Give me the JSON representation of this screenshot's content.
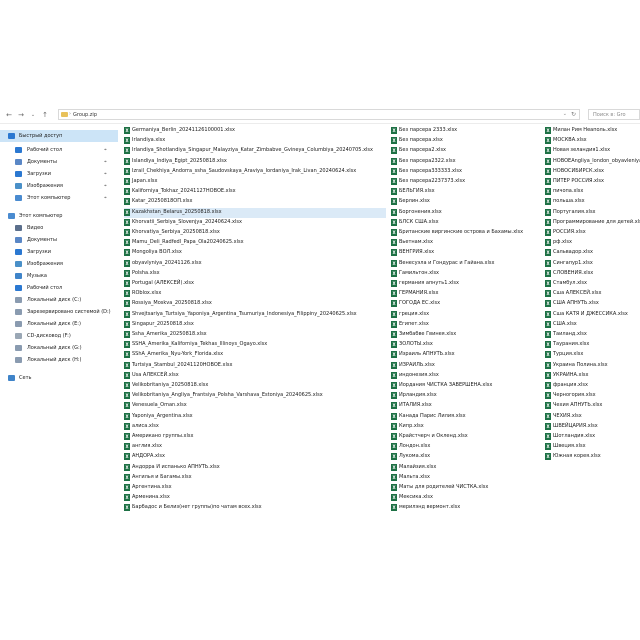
{
  "address": {
    "path": "Group.zip"
  },
  "search": {
    "placeholder": "Поиск в: Gro"
  },
  "nav": [
    {
      "label": "Быстрый доступ",
      "icon": "star-icon",
      "color": "#2b78d1",
      "pin": false,
      "sub": false,
      "active": true
    },
    {
      "label": "Рабочий стол",
      "icon": "desktop-icon",
      "color": "#2b78d1",
      "pin": true,
      "sub": true,
      "active": false
    },
    {
      "label": "Документы",
      "icon": "documents-icon",
      "color": "#5a87c6",
      "pin": true,
      "sub": true,
      "active": false
    },
    {
      "label": "Загрузки",
      "icon": "downloads-icon",
      "color": "#2b78d1",
      "pin": true,
      "sub": true,
      "active": false
    },
    {
      "label": "Изображения",
      "icon": "pictures-icon",
      "color": "#4a90c8",
      "pin": true,
      "sub": true,
      "active": false
    },
    {
      "label": "Этот компьютер",
      "icon": "computer-icon",
      "color": "#4a8bd0",
      "pin": true,
      "sub": true,
      "active": false
    },
    {
      "label": "Этот компьютер",
      "icon": "computer-icon",
      "color": "#4a8bd0",
      "pin": false,
      "sub": false,
      "active": false
    },
    {
      "label": "Видео",
      "icon": "video-icon",
      "color": "#5b6f8c",
      "pin": false,
      "sub": true,
      "active": false
    },
    {
      "label": "Документы",
      "icon": "documents-icon",
      "color": "#5a87c6",
      "pin": false,
      "sub": true,
      "active": false
    },
    {
      "label": "Загрузки",
      "icon": "downloads-icon",
      "color": "#2b78d1",
      "pin": false,
      "sub": true,
      "active": false
    },
    {
      "label": "Изображения",
      "icon": "pictures-icon",
      "color": "#4a90c8",
      "pin": false,
      "sub": true,
      "active": false
    },
    {
      "label": "Музыка",
      "icon": "music-icon",
      "color": "#3f84c9",
      "pin": false,
      "sub": true,
      "active": false
    },
    {
      "label": "Рабочий стол",
      "icon": "desktop-icon",
      "color": "#2b78d1",
      "pin": false,
      "sub": true,
      "active": false
    },
    {
      "label": "Локальный диск (C:)",
      "icon": "drive-icon",
      "color": "#8a9bb0",
      "pin": false,
      "sub": true,
      "active": false
    },
    {
      "label": "Зарезервировано системой (D:)",
      "icon": "drive-icon",
      "color": "#8a9bb0",
      "pin": false,
      "sub": true,
      "active": false
    },
    {
      "label": "Локальный диск (E:)",
      "icon": "drive-icon",
      "color": "#8a9bb0",
      "pin": false,
      "sub": true,
      "active": false
    },
    {
      "label": "CD-дисковод (F:)",
      "icon": "cd-drive-icon",
      "color": "#9aa7b5",
      "pin": false,
      "sub": true,
      "active": false
    },
    {
      "label": "Локальный диск (G:)",
      "icon": "drive-icon",
      "color": "#8a9bb0",
      "pin": false,
      "sub": true,
      "active": false
    },
    {
      "label": "Локальный диск (H:)",
      "icon": "drive-icon",
      "color": "#8a9bb0",
      "pin": false,
      "sub": true,
      "active": false
    },
    {
      "label": "Сеть",
      "icon": "network-icon",
      "color": "#3f84c9",
      "pin": false,
      "sub": false,
      "active": false
    }
  ],
  "columns": [
    [
      "Germaniya_Berlin_20241126100001.xlsx",
      "Irlandiya.xlsx",
      "Irlandiya_Shotlandiya_Singapur_Malayziya_Katar_Zimbabve_Gvineya_Columbiya_20240705.xlsx",
      "Islandiya_Indiya_Egipt_20250818.xlsx",
      "Izrail_Chekhiya_Andorra_ssha_Saudovskaya_Araviya_Iordaniya_Irak_Livan_20240624.xlsx",
      "Japan.xlsx",
      "Kaliforniya_Tokhaz_20241127НОВОЕ.xlsx",
      "Katar_20250818ОП.xlsx",
      "Kazakhstan_Belarus_20250818.xlsx",
      "Khorvatii_Serbiya_Slovenjya_20240624.xlsx",
      "Khorvatiya_Serbiya_20250818.xlsx",
      "Mamu_Deli_Radfedl_Papa_Ola20240625.xlsx",
      "Mongoliya ВОЛ.xlsx",
      "obyavlyniya_20241126.xlsx",
      "Polsha.xlsx",
      "Portugal (АЛЕКСЕЙ).xlsx",
      "ROblox.xlsx",
      "Rossiya_Moskva_20250818.xlsx",
      "Shvejtsariya_Turtsiya_Yaponiya_Argentina_Tsumuriya_Indonesiya_Filippiny_20240625.xlsx",
      "Singapur_20250818.xlsx",
      "Ssha_Amerika_20250818.xlsx",
      "SSHA_Amerika_Kaliforniya_Tekhas_Illinoys_Ogayo.xlsx",
      "SShA_Amerika_Nyu-York_Florida.xlsx",
      "Turtsiya_Stambul_20241120НОВОЕ.xlsx",
      "Usa АЛЕКСЕЙ.xlsx",
      "Velikobritaniya_20250818.xlsx",
      "Velikobritaniya_Angliya_Frantsiya_Polsha_Varshava_Estoniya_20240625.xlsx",
      "Venesuela_Oman.xlsx",
      "Yaponiya_Argentina.xlsx",
      "алиса.xlsx",
      "Американо группы.xlsx",
      "англия.xlsx",
      "АНДОРА.xlsx",
      "Андорра И испанько АПНУТЬ.xlsx",
      "Ангилья и Багамы.xlsx",
      "Аргентина.xlsx",
      "Арменина.xlsx",
      "Барбадос и Белиз(нет группы)по чатам всех.xlsx"
    ],
    [
      "Без парсера 2333.xlsx",
      "Без парсера.xlsx",
      "Без парсера2.xlsx",
      "Без парсера2322.xlsx",
      "Без парсера333333.xlsx",
      "Без парсера2237373.xlsx",
      "БЕЛЬГИЯ.xlsx",
      "Берлин.xlsx",
      "Боргонения.xlsx",
      "БЛСК США.xlsx",
      "Британские виргинские острова и Бахамы.xlsx",
      "Вьетнам.xlsx",
      "ВЕНГРИЯ.xlsx",
      "Венесуэла и Гондурас и Гайана.xlsx",
      "Гамильтон.xlsx",
      "германия апнуть1.xlsx",
      "ГЕРМАНИЯ.xlsx",
      "ГОГОДА ЕС.xlsx",
      "греция.xlsx",
      "Египет.xlsx",
      "Зимбабве Гвинея.xlsx",
      "ЗОЛОТЫ.xlsx",
      "Израиль АПНУТЬ.xlsx",
      "ИЗРАИЛЬ.xlsx",
      "индонезия.xlsx",
      "Иордания ЧИСТКА ЗАВЕРШЕНА.xlsx",
      "Ирландия.xlsx",
      "ИТАЛИЯ.xlsx",
      "Канада Парис Лилия.xlsx",
      "Кипр.xlsx",
      "Крайстчерч и Окленд.xlsx",
      "Лондон.xlsx",
      "Лукома.xlsx",
      "Малайзия.xlsx",
      "Мальта.xlsx",
      "Маты для родителей ЧИСТКА.xlsx",
      "Мексика.xlsx",
      "мерилэнд вермонт.xlsx"
    ],
    [
      "Милан Рим Неаполь.xlsx",
      "МОСКВА.xlsx",
      "Новая зеландия1.xlsx",
      "НОВОЕAngliya_london_obyavleniya.xlsx",
      "НОВОСИБИРСК.xlsx",
      "ПИТЕР РОССИЯ.xlsx",
      "пичопа.xlsx",
      "польша.xlsx",
      "Португалия.xlsx",
      "Программирование для детей.xlsx",
      "РОССИЯ.xlsx",
      "рф.xlsx",
      "Сальвадор.xlsx",
      "Сингапур1.xlsx",
      "СЛОВЕНИЯ.xlsx",
      "Стамбул.xlsx",
      "Сша АЛЕКСЕЙ.xlsx",
      "США АПНУТЬ.xlsx",
      "Сша КАТЯ И ДЖЕССИКА.xlsx",
      "США.xlsx",
      "Таиланд.xlsx",
      "Таурания.xlsx",
      "Турция.xlsx",
      "Украина Полина.xlsx",
      "УКРАИНА.xlsx",
      "франция.xlsx",
      "Черногория.xlsx",
      "Чехия АПНУТЬ.xlsx",
      "ЧЕХИЯ.xlsx",
      "ШВЕЙЦАРИЯ.xlsx",
      "Шотландия.xlsx",
      "Швеция.xlsx",
      "Южная корея.xlsx"
    ]
  ],
  "selected_file": "Kazakhstan_Belarus_20250818.xlsx"
}
